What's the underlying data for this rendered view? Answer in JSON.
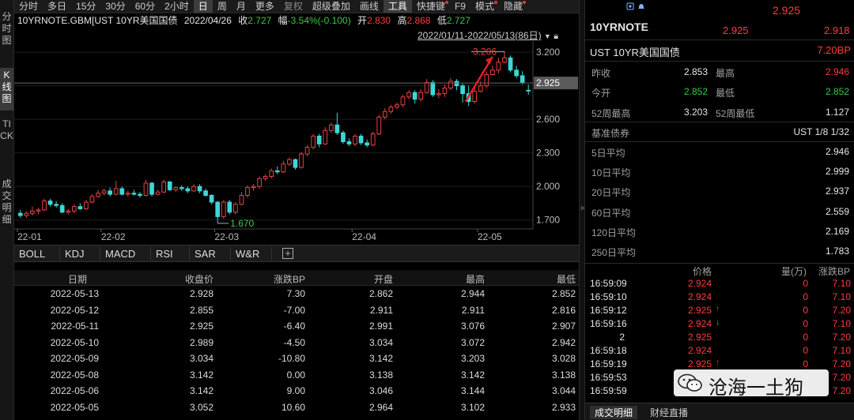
{
  "left_tabs": [
    "分时图",
    "K线图",
    "TICK",
    "成交明细"
  ],
  "toolbar": {
    "items": [
      {
        "label": "分时"
      },
      {
        "label": "多日"
      },
      {
        "label": "15分"
      },
      {
        "label": "30分"
      },
      {
        "label": "60分"
      },
      {
        "label": "2小时"
      },
      {
        "label": "日",
        "active": true
      },
      {
        "label": "周"
      },
      {
        "label": "月"
      },
      {
        "label": "更多"
      },
      {
        "label": "复权",
        "dim": true
      },
      {
        "label": "超级叠加"
      },
      {
        "label": "画线"
      },
      {
        "label": "工具",
        "active": true
      },
      {
        "label": "快捷键",
        "badge": true
      },
      {
        "label": "F9"
      },
      {
        "label": "模式",
        "badge": true
      },
      {
        "label": "隐藏",
        "badge": true
      }
    ]
  },
  "info": {
    "name": "10YRNOTE.GBM[UST 10YR美国国债",
    "date": "2022/04/26",
    "close_label": "收",
    "close": "2.727",
    "change_label": "幅",
    "change": "-3.54%(-0.100)",
    "open_label": "开",
    "open": "2.830",
    "high_label": "高",
    "high": "2.868",
    "low_label": "低",
    "low": "2.727"
  },
  "range_text": "2022/01/11-2022/05/13(86日)",
  "chart_data": {
    "type": "candlestick",
    "y_ticks": [
      "3.200",
      "2.900",
      "2.600",
      "2.300",
      "2.000",
      "1.700"
    ],
    "ylim": [
      1.62,
      3.3
    ],
    "x_ticks": [
      "22-01",
      "22-02",
      "22-03",
      "22-04",
      "22-05"
    ],
    "current_price": "2.925",
    "annotations": {
      "high": "3.206",
      "low": "1.670"
    },
    "colors": {
      "up": "#e8423f",
      "down": "#3ed6d6"
    },
    "candles": [
      [
        1.76,
        1.74,
        1.79,
        1.72
      ],
      [
        1.74,
        1.76,
        1.78,
        1.72
      ],
      [
        1.76,
        1.78,
        1.82,
        1.74
      ],
      [
        1.78,
        1.79,
        1.81,
        1.75
      ],
      [
        1.79,
        1.87,
        1.89,
        1.78
      ],
      [
        1.87,
        1.84,
        1.89,
        1.82
      ],
      [
        1.84,
        1.83,
        1.87,
        1.81
      ],
      [
        1.83,
        1.77,
        1.85,
        1.76
      ],
      [
        1.77,
        1.78,
        1.8,
        1.75
      ],
      [
        1.78,
        1.82,
        1.84,
        1.76
      ],
      [
        1.82,
        1.8,
        1.85,
        1.79
      ],
      [
        1.8,
        1.86,
        1.88,
        1.79
      ],
      [
        1.86,
        1.91,
        1.93,
        1.85
      ],
      [
        1.91,
        1.94,
        1.97,
        1.9
      ],
      [
        1.94,
        1.96,
        1.98,
        1.92
      ],
      [
        1.96,
        1.93,
        1.99,
        1.91
      ],
      [
        1.93,
        1.98,
        2.05,
        1.92
      ],
      [
        1.98,
        1.93,
        2.0,
        1.92
      ],
      [
        1.93,
        1.94,
        1.96,
        1.91
      ],
      [
        1.94,
        1.93,
        1.97,
        1.92
      ],
      [
        1.93,
        1.92,
        1.95,
        1.9
      ],
      [
        1.92,
        2.03,
        2.06,
        1.91
      ],
      [
        2.03,
        1.93,
        2.04,
        1.91
      ],
      [
        1.93,
        1.95,
        1.97,
        1.92
      ],
      [
        1.95,
        2.04,
        2.06,
        1.94
      ],
      [
        2.04,
        1.97,
        2.05,
        1.96
      ],
      [
        1.97,
        1.99,
        2.0,
        1.95
      ],
      [
        1.99,
        1.98,
        2.01,
        1.96
      ],
      [
        1.98,
        1.96,
        2.0,
        1.94
      ],
      [
        1.96,
        2.0,
        2.02,
        1.95
      ],
      [
        2.0,
        1.96,
        2.02,
        1.94
      ],
      [
        1.96,
        1.92,
        1.98,
        1.91
      ],
      [
        1.92,
        1.86,
        1.93,
        1.84
      ],
      [
        1.86,
        1.73,
        1.87,
        1.67
      ],
      [
        1.73,
        1.86,
        1.88,
        1.71
      ],
      [
        1.86,
        1.77,
        1.88,
        1.75
      ],
      [
        1.77,
        1.84,
        1.86,
        1.75
      ],
      [
        1.84,
        1.92,
        1.95,
        1.83
      ],
      [
        1.92,
        1.99,
        2.01,
        1.9
      ],
      [
        1.99,
        2.0,
        2.02,
        1.96
      ],
      [
        2.0,
        2.07,
        2.09,
        1.98
      ],
      [
        2.07,
        2.09,
        2.11,
        2.05
      ],
      [
        2.09,
        2.14,
        2.16,
        2.07
      ],
      [
        2.14,
        2.13,
        2.18,
        2.11
      ],
      [
        2.13,
        2.2,
        2.23,
        2.12
      ],
      [
        2.2,
        2.24,
        2.26,
        2.18
      ],
      [
        2.24,
        2.17,
        2.25,
        2.15
      ],
      [
        2.17,
        2.29,
        2.31,
        2.16
      ],
      [
        2.29,
        2.35,
        2.37,
        2.27
      ],
      [
        2.35,
        2.45,
        2.47,
        2.33
      ],
      [
        2.45,
        2.38,
        2.47,
        2.35
      ],
      [
        2.38,
        2.5,
        2.53,
        2.37
      ],
      [
        2.5,
        2.55,
        2.57,
        2.48
      ],
      [
        2.55,
        2.48,
        2.66,
        2.46
      ],
      [
        2.48,
        2.4,
        2.5,
        2.38
      ],
      [
        2.4,
        2.38,
        2.43,
        2.36
      ],
      [
        2.38,
        2.45,
        2.47,
        2.36
      ],
      [
        2.45,
        2.39,
        2.47,
        2.37
      ],
      [
        2.39,
        2.37,
        2.42,
        2.35
      ],
      [
        2.37,
        2.47,
        2.49,
        2.36
      ],
      [
        2.47,
        2.62,
        2.64,
        2.46
      ],
      [
        2.62,
        2.67,
        2.7,
        2.6
      ],
      [
        2.67,
        2.71,
        2.73,
        2.65
      ],
      [
        2.71,
        2.73,
        2.75,
        2.69
      ],
      [
        2.73,
        2.8,
        2.82,
        2.71
      ],
      [
        2.8,
        2.84,
        2.86,
        2.78
      ],
      [
        2.84,
        2.78,
        2.86,
        2.74
      ],
      [
        2.78,
        2.84,
        2.87,
        2.76
      ],
      [
        2.84,
        2.93,
        2.96,
        2.83
      ],
      [
        2.93,
        2.82,
        2.95,
        2.8
      ],
      [
        2.82,
        2.83,
        2.87,
        2.79
      ],
      [
        2.83,
        2.88,
        2.91,
        2.8
      ],
      [
        2.88,
        2.94,
        2.97,
        2.86
      ],
      [
        2.94,
        2.9,
        2.96,
        2.86
      ],
      [
        2.9,
        2.83,
        2.92,
        2.75
      ],
      [
        2.83,
        2.76,
        2.9,
        2.72
      ],
      [
        2.76,
        2.85,
        2.88,
        2.74
      ],
      [
        2.85,
        2.9,
        2.94,
        2.84
      ],
      [
        2.9,
        3.0,
        3.03,
        2.88
      ],
      [
        3.0,
        3.04,
        3.08,
        2.99
      ],
      [
        3.04,
        3.11,
        3.15,
        3.01
      ],
      [
        3.11,
        3.15,
        3.21,
        3.1
      ],
      [
        3.15,
        3.04,
        3.17,
        3.02
      ],
      [
        3.04,
        2.99,
        3.08,
        2.97
      ],
      [
        2.99,
        2.93,
        3.03,
        2.91
      ],
      [
        2.86,
        2.86,
        2.91,
        2.82
      ]
    ]
  },
  "indicator_tabs": [
    "BOLL",
    "KDJ",
    "MACD",
    "RSI",
    "SAR",
    "W&R"
  ],
  "table": {
    "headers": [
      "日期",
      "收盘价",
      "涨跌BP",
      "开盘",
      "最高",
      "最低"
    ],
    "rows": [
      [
        "2022-05-13",
        "2.928",
        "7.30",
        "2.862",
        "2.944",
        "2.852"
      ],
      [
        "2022-05-12",
        "2.855",
        "-7.00",
        "2.911",
        "2.911",
        "2.816"
      ],
      [
        "2022-05-11",
        "2.925",
        "-6.40",
        "2.991",
        "3.076",
        "2.907"
      ],
      [
        "2022-05-10",
        "2.989",
        "-4.50",
        "3.034",
        "3.072",
        "2.942"
      ],
      [
        "2022-05-09",
        "3.034",
        "-10.80",
        "3.142",
        "3.203",
        "3.028"
      ],
      [
        "2022-05-08",
        "3.142",
        "0.00",
        "3.138",
        "3.142",
        "3.138"
      ],
      [
        "2022-05-06",
        "3.142",
        "9.00",
        "3.046",
        "3.144",
        "3.044"
      ],
      [
        "2022-05-05",
        "3.052",
        "10.60",
        "2.964",
        "3.102",
        "2.933"
      ]
    ]
  },
  "quote": {
    "top_price": "2.925",
    "bid": "2.925",
    "ask": "2.918",
    "code": "10YRNOTE",
    "name": "UST 10YR美国国债",
    "change_bp": "7.20BP",
    "prev_close_label": "昨收",
    "prev_close": "2.853",
    "high_label": "最高",
    "high": "2.946",
    "open_label": "今开",
    "open": "2.852",
    "low_label": "最低",
    "low": "2.852",
    "wk52_high_label": "52周最高",
    "wk52_high": "3.203",
    "wk52_low_label": "52周最低",
    "wk52_low": "1.127",
    "bench_label": "基准债券",
    "bench": "UST 1/8 1/32",
    "avgs": [
      {
        "label": "5日平均",
        "value": "2.946"
      },
      {
        "label": "10日平均",
        "value": "2.999"
      },
      {
        "label": "20日平均",
        "value": "2.937"
      },
      {
        "label": "60日平均",
        "value": "2.559"
      },
      {
        "label": "120日平均",
        "value": "2.169"
      },
      {
        "label": "250日平均",
        "value": "1.783"
      }
    ]
  },
  "trades": {
    "headers": [
      "价格",
      "量(万)",
      "涨跌BP"
    ],
    "rows": [
      {
        "time": "16:59:09",
        "price": "2.924",
        "arrow": "",
        "vol": "0",
        "bp": "7.10"
      },
      {
        "time": "16:59:10",
        "price": "2.924",
        "arrow": "",
        "vol": "0",
        "bp": "7.10"
      },
      {
        "time": "16:59:12",
        "price": "2.925",
        "arrow": "↑",
        "vol": "0",
        "bp": "7.20"
      },
      {
        "time": "16:59:16",
        "price": "2.924",
        "arrow": "↓",
        "vol": "0",
        "bp": "7.10"
      },
      {
        "time": "2",
        "price": "2.925",
        "arrow": "",
        "vol": "0",
        "bp": "7.20"
      },
      {
        "time": "16:59:18",
        "price": "2.924",
        "arrow": "",
        "vol": "0",
        "bp": "7.10"
      },
      {
        "time": "16:59:19",
        "price": "2.925",
        "arrow": "↑",
        "vol": "0",
        "bp": "7.20"
      },
      {
        "time": "16:59:53",
        "price": "2.925",
        "arrow": "",
        "vol": "0",
        "bp": "7.20"
      },
      {
        "time": "16:59:59",
        "price": "2.925",
        "arrow": "",
        "vol": "0",
        "bp": "7.20"
      }
    ]
  },
  "bottom_tabs": [
    "成交明细",
    "财经直播"
  ],
  "watermark": "沧海一土狗"
}
